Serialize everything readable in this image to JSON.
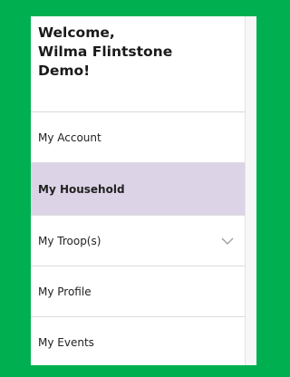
{
  "sidebar": {
    "welcome_lines": [
      "Welcome,",
      "Wilma Flintstone",
      "Demo!"
    ],
    "items": [
      {
        "label": "My Account",
        "active": false
      },
      {
        "label": "My Household",
        "active": true
      },
      {
        "label": "My Troop(s)",
        "active": false,
        "expandable": true,
        "icon": "chevron-down-icon"
      },
      {
        "label": "My Profile",
        "active": false
      },
      {
        "label": "My Events",
        "active": false
      }
    ]
  },
  "colors": {
    "frame": "#00b050",
    "active_bg": "#dcd4e6"
  }
}
